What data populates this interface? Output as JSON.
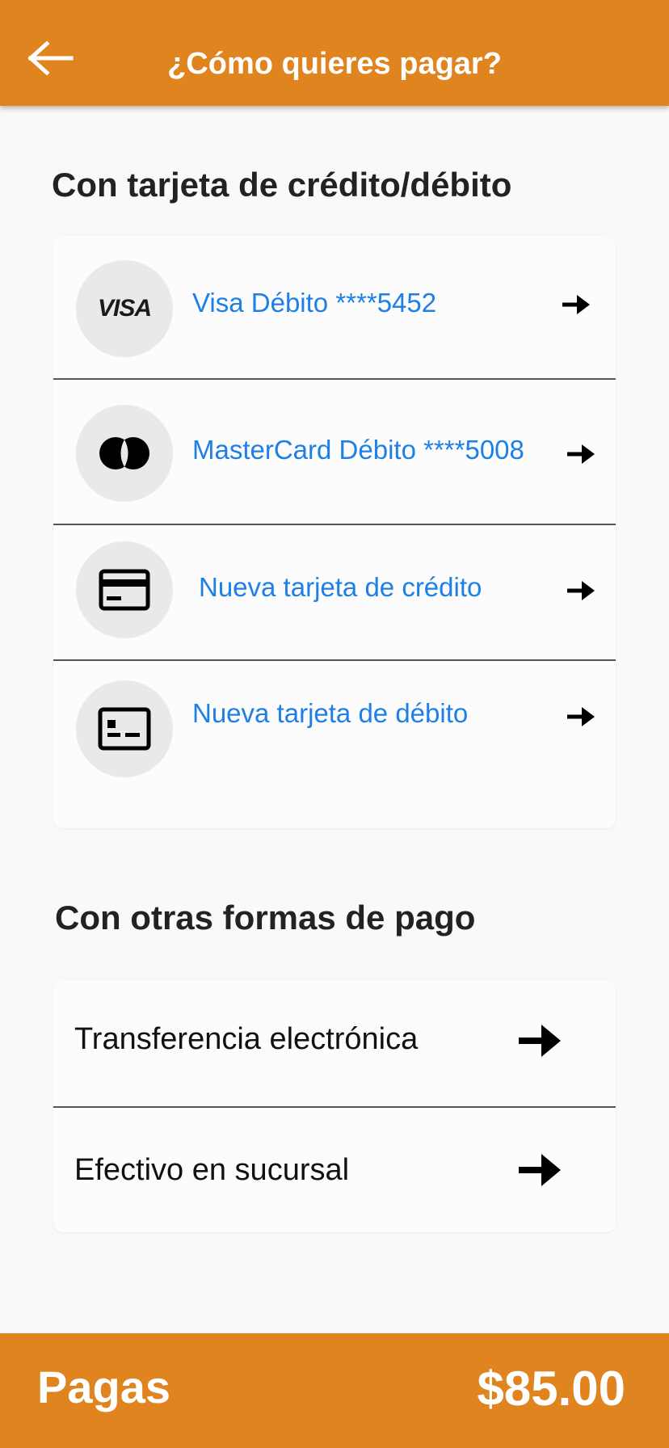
{
  "header": {
    "title": "¿Cómo quieres pagar?",
    "back_icon": "arrow-left-icon",
    "background": "#df841e"
  },
  "cards_section": {
    "title": "Con tarjeta de crédito/débito",
    "items": [
      {
        "label": "Visa Débito ****5452",
        "icon": "visa-logo",
        "logo_text": "VISA"
      },
      {
        "label": "MasterCard Débito ****5008",
        "icon": "mastercard-logo"
      },
      {
        "label": "Nueva tarjeta de crédito",
        "icon": "credit-card-icon"
      },
      {
        "label": "Nueva tarjeta de débito",
        "icon": "id-card-icon"
      }
    ]
  },
  "other_section": {
    "title": "Con otras formas de pago",
    "items": [
      {
        "label": "Transferencia electrónica",
        "icon": "arrow-right-icon"
      },
      {
        "label": "Efectivo en sucursal",
        "icon": "arrow-right-icon"
      }
    ]
  },
  "footer": {
    "label": "Pagas",
    "amount": "$85.00",
    "background": "#df841e"
  },
  "colors": {
    "accent": "#df841e",
    "link": "#1e7fe6",
    "text": "#222222"
  }
}
